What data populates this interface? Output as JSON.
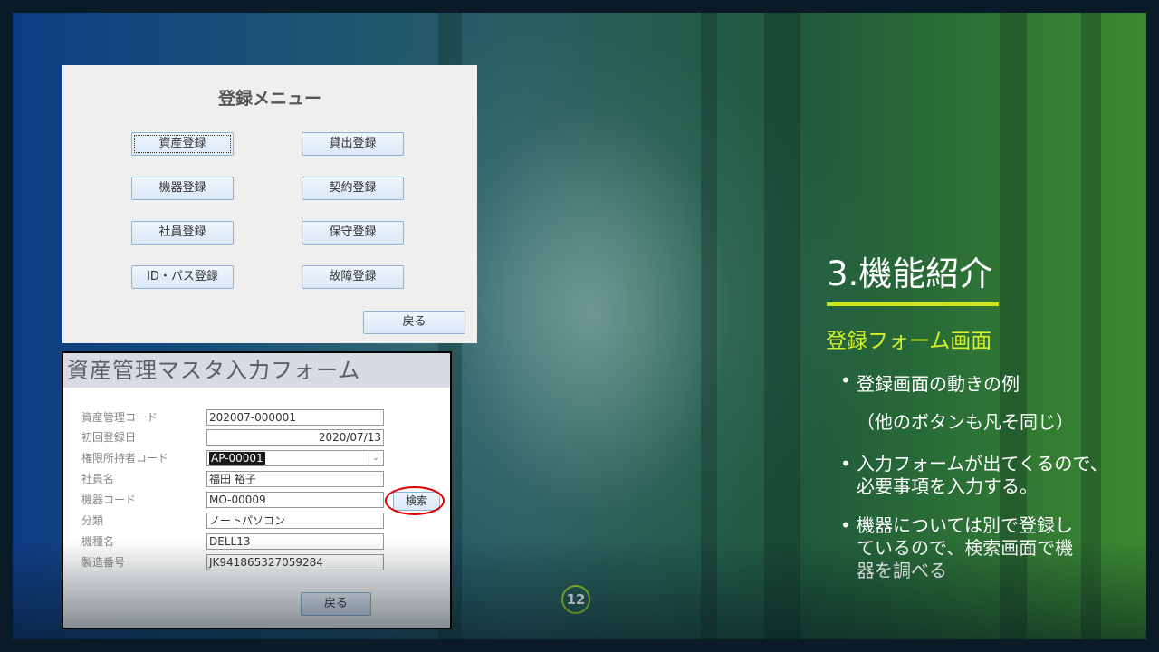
{
  "menu": {
    "title": "登録メニュー",
    "buttons": {
      "asset": "資産登録",
      "lending": "貸出登録",
      "device": "機器登録",
      "contract": "契約登録",
      "employee": "社員登録",
      "maintenance": "保守登録",
      "id_pass": "ID・パス登録",
      "failure": "故障登録",
      "back": "戻る"
    }
  },
  "form": {
    "title": "資産管理マスタ入力フォーム",
    "fields": [
      {
        "label": "資産管理コード",
        "value": "202007-000001"
      },
      {
        "label": "初回登録日",
        "value": "2020/07/13"
      },
      {
        "label": "権限所持者コード",
        "value": "AP-00001"
      },
      {
        "label": "社員名",
        "value": "福田 裕子"
      },
      {
        "label": "機器コード",
        "value": "MO-00009"
      },
      {
        "label": "分類",
        "value": "ノートパソコン"
      },
      {
        "label": "機種名",
        "value": "DELL13"
      },
      {
        "label": "製造番号",
        "value": "JK941865327059284"
      }
    ],
    "search_button": "検索",
    "back_button": "戻る"
  },
  "page_number": "12",
  "section": {
    "title": "3.機能紹介",
    "subtitle": "登録フォーム画面",
    "bullets": [
      {
        "line1": "登録画面の動きの例",
        "line2": "（他のボタンも凡そ同じ）"
      },
      {
        "line1": "入力フォームが出てくるので、",
        "line2": "必要事項を入力する。"
      },
      {
        "line1": "機器については別で登録し",
        "line2": "ているので、検索画面で機",
        "line3": "器を調べる"
      }
    ]
  },
  "colors": {
    "accent_green": "#d3f02a",
    "rule_yellow": "#cfe61e",
    "highlight_red": "#dd0000",
    "button_blue": "#dbe8f6"
  }
}
